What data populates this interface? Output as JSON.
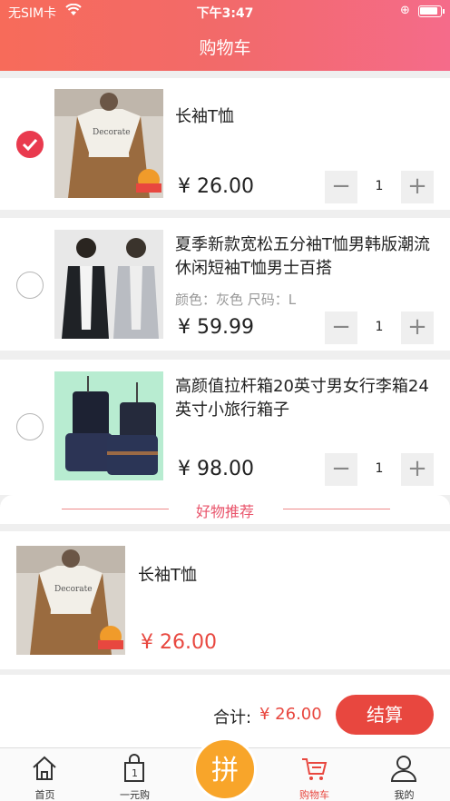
{
  "status_bar": {
    "carrier": "无SIM卡",
    "time": "下午3:47"
  },
  "header": {
    "title": "购物车"
  },
  "cart_items": [
    {
      "name": "长袖T恤",
      "spec": "",
      "price": "¥ 26.00",
      "qty": "1",
      "checked": true
    },
    {
      "name": "夏季新款宽松五分袖T恤男韩版潮流休闲短袖T恤男士百搭",
      "spec": "颜色：灰色 尺码：L",
      "price": "¥ 59.99",
      "qty": "1",
      "checked": false
    },
    {
      "name": "高颜值拉杆箱20英寸男女行李箱24英寸小旅行箱子",
      "spec": "",
      "price": "¥ 98.00",
      "qty": "1",
      "checked": false
    }
  ],
  "recommend": {
    "title": "好物推荐",
    "items": [
      {
        "name": "长袖T恤",
        "price": "¥ 26.00"
      }
    ]
  },
  "summary": {
    "total_label": "合计:",
    "total_value": "¥ 26.00",
    "checkout_label": "结算"
  },
  "tabbar": {
    "tabs": [
      {
        "label": "首页",
        "icon": "home-icon"
      },
      {
        "label": "一元购",
        "icon": "bag-icon"
      },
      {
        "label": "拼",
        "icon": "center-pin-button"
      },
      {
        "label": "购物车",
        "icon": "cart-icon",
        "active": true
      },
      {
        "label": "我的",
        "icon": "user-icon"
      }
    ]
  },
  "colors": {
    "accent": "#e8473f",
    "check": "#e93a4e",
    "center": "#f8a52a"
  }
}
